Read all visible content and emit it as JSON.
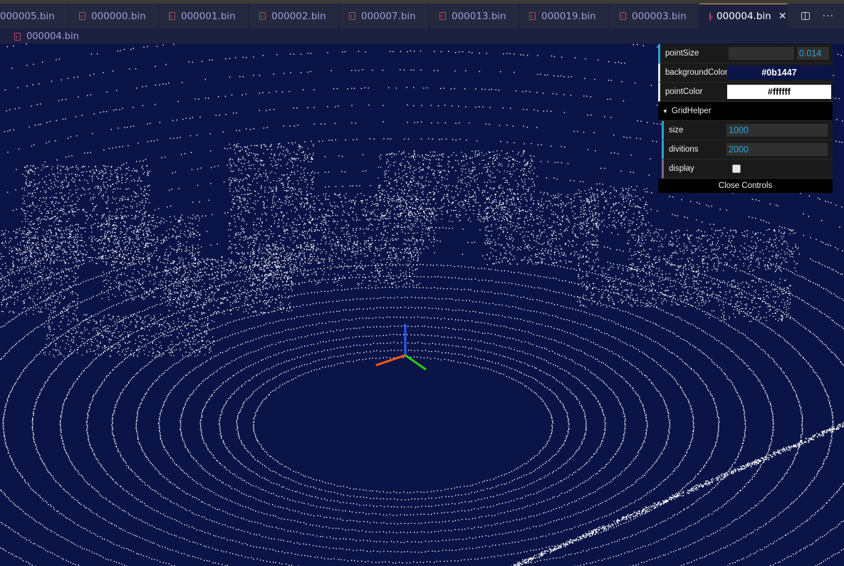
{
  "tabs": [
    {
      "label": "000005.bin",
      "active": false,
      "icon": false
    },
    {
      "label": "000000.bin",
      "active": false,
      "icon": true
    },
    {
      "label": "000001.bin",
      "active": false,
      "icon": true
    },
    {
      "label": "000002.bin",
      "active": false,
      "icon": true
    },
    {
      "label": "000007.bin",
      "active": false,
      "icon": true
    },
    {
      "label": "000013.bin",
      "active": false,
      "icon": true
    },
    {
      "label": "000019.bin",
      "active": false,
      "icon": true
    },
    {
      "label": "000003.bin",
      "active": false,
      "icon": true
    },
    {
      "label": "000004.bin",
      "active": true,
      "icon": true
    }
  ],
  "tab_close_glyph": "✕",
  "actions": {
    "split_icon": "split-editor-icon",
    "more_glyph": "···"
  },
  "breadcrumb": {
    "label": "000004.bin"
  },
  "gui": {
    "pointSize": {
      "label": "pointSize",
      "value": "0.014"
    },
    "backgroundColor": {
      "label": "backgroundColor",
      "value": "#0b1447"
    },
    "pointColor": {
      "label": "pointColor",
      "value": "#ffffff"
    },
    "gridHelper": {
      "title": "GridHelper",
      "size": {
        "label": "size",
        "value": "1000"
      },
      "divitions": {
        "label": "divitions",
        "value": "2000"
      },
      "display": {
        "label": "display",
        "checked": false
      }
    },
    "close_label": "Close Controls"
  },
  "colors": {
    "background": "#0b1447",
    "points": "#ffffff",
    "axis_x": "#ff5a14",
    "axis_y": "#2ecc17",
    "axis_z": "#2a5cff"
  }
}
